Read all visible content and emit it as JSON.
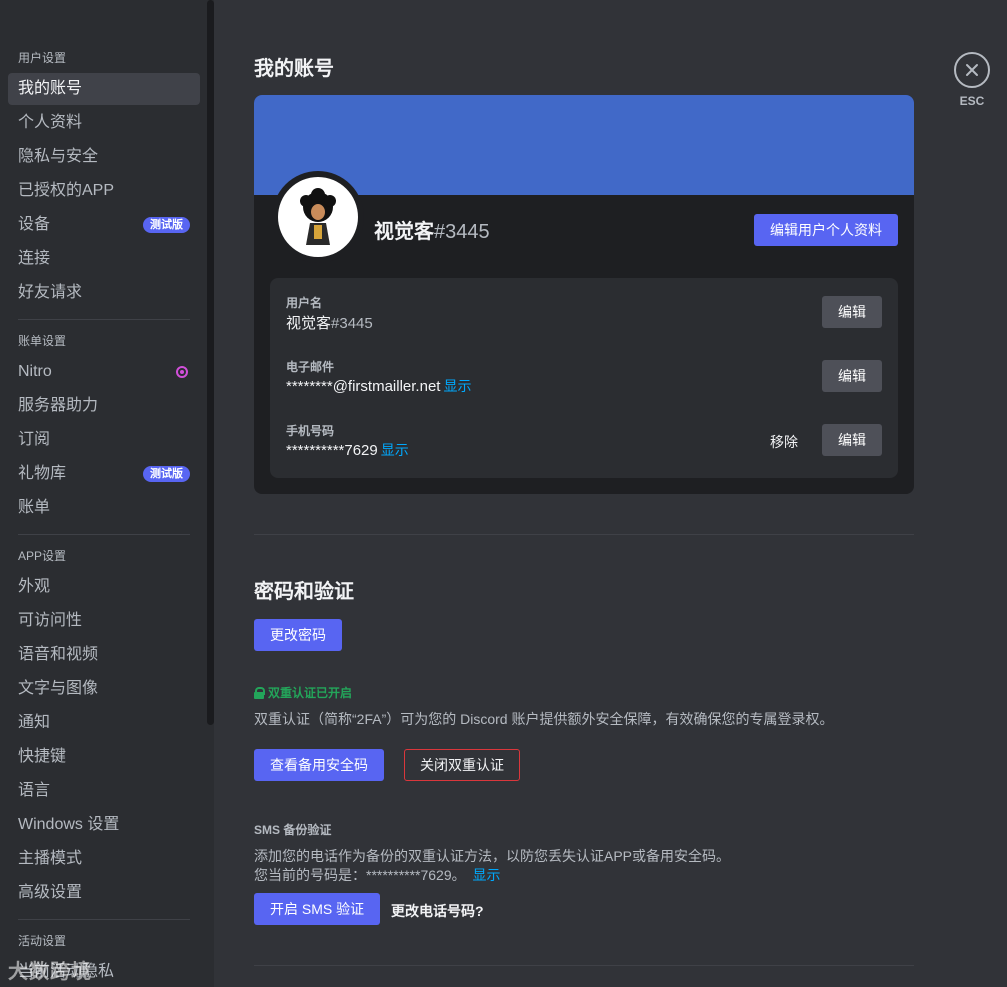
{
  "sidebar": {
    "sections": [
      {
        "header": "用户设置",
        "items": [
          {
            "label": "我的账号",
            "active": true
          },
          {
            "label": "个人资料"
          },
          {
            "label": "隐私与安全"
          },
          {
            "label": "已授权的APP"
          },
          {
            "label": "设备",
            "badge": "测试版"
          },
          {
            "label": "连接"
          },
          {
            "label": "好友请求"
          }
        ]
      },
      {
        "header": "账单设置",
        "items": [
          {
            "label": "Nitro",
            "icon": "nitro-icon"
          },
          {
            "label": "服务器助力"
          },
          {
            "label": "订阅"
          },
          {
            "label": "礼物库",
            "badge": "测试版"
          },
          {
            "label": "账单"
          }
        ]
      },
      {
        "header": "APP设置",
        "items": [
          {
            "label": "外观"
          },
          {
            "label": "可访问性"
          },
          {
            "label": "语音和视频"
          },
          {
            "label": "文字与图像"
          },
          {
            "label": "通知"
          },
          {
            "label": "快捷键"
          },
          {
            "label": "语言"
          },
          {
            "label": "Windows 设置"
          },
          {
            "label": "主播模式"
          },
          {
            "label": "高级设置"
          }
        ]
      },
      {
        "header": "活动设置",
        "items": [
          {
            "label": "当前活动隐私"
          }
        ]
      }
    ],
    "watermark": "大数跨境"
  },
  "main": {
    "title": "我的账号",
    "profile": {
      "name": "视觉客",
      "tag": "#3445",
      "edit_profile_label": "编辑用户个人资料",
      "banner_color": "#4169c8"
    },
    "info": {
      "username": {
        "label": "用户名",
        "name": "视觉客",
        "tag": "#3445",
        "edit_label": "编辑"
      },
      "email": {
        "label": "电子邮件",
        "value": "********@firstmailler.net",
        "reveal_label": "显示",
        "edit_label": "编辑"
      },
      "phone": {
        "label": "手机号码",
        "value": "**********7629",
        "reveal_label": "显示",
        "remove_label": "移除",
        "edit_label": "编辑"
      }
    },
    "password": {
      "title": "密码和验证",
      "change_password_label": "更改密码",
      "twofa_status": "双重认证已开启",
      "twofa_desc": "双重认证（简称“2FA”）可为您的 Discord 账户提供额外安全保障，有效确保您的专属登录权。",
      "view_backup_codes_label": "查看备用安全码",
      "disable_2fa_label": "关闭双重认证",
      "sms_header": "SMS 备份验证",
      "sms_desc": "添加您的电话作为备份的双重认证方法，以防您丢失认证APP或备用安全码。",
      "sms_current_prefix": "您当前的号码是：**********7629。",
      "sms_reveal_label": "显示",
      "enable_sms_label": "开启 SMS 验证",
      "change_phone_label": "更改电话号码?"
    }
  },
  "close": {
    "esc_label": "ESC"
  },
  "colors": {
    "accent": "#5865f2",
    "success": "#23a55a",
    "danger": "#da373c",
    "link": "#00a8fc"
  }
}
